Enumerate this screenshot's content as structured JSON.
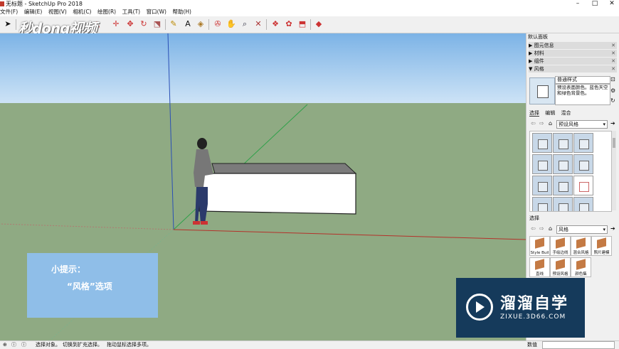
{
  "window": {
    "title": "无标题 - SketchUp Pro 2018"
  },
  "menu": [
    "文件(F)",
    "编辑(E)",
    "视图(V)",
    "相机(C)",
    "绘图(R)",
    "工具(T)",
    "窗口(W)",
    "帮助(H)"
  ],
  "logo": {
    "text": "秒dong视频"
  },
  "toolbar": {
    "icons": [
      "select-icon",
      "eraser-icon",
      "paint-icon",
      "line-icon",
      "arc-icon",
      "rectangle-icon",
      "pushpull-icon",
      "move-icon",
      "rotate-icon",
      "scale-icon",
      "tape-icon",
      "text-icon",
      "paint-bucket-icon",
      "orbit-icon",
      "pan-icon",
      "zoom-icon",
      "zoom-extents-icon",
      "warehouse-icon",
      "extension-icon",
      "share-icon",
      "ruby-icon"
    ]
  },
  "tip": {
    "line1": "小提示：",
    "line2": "“风格”选项"
  },
  "tray": {
    "title": "默认面板",
    "sections": [
      {
        "label": "图元信息",
        "collapsed": true
      },
      {
        "label": "材料",
        "collapsed": true
      },
      {
        "label": "组件",
        "collapsed": true
      },
      {
        "label": "风格",
        "collapsed": false
      }
    ],
    "style": {
      "name": "普通样式",
      "description": "预设表面颜色。蓝色天空和绿色背景色。"
    },
    "tabs": [
      "选择",
      "编辑",
      "混合"
    ],
    "dropdown1": "预设风格",
    "mix_label": "选择",
    "dropdown2": "风格",
    "swatches": [
      "Style Buil",
      "手绘边线",
      "混合风格",
      "照片建模",
      "直线",
      "预设风格",
      "颜色集"
    ]
  },
  "watermark": {
    "title": "溜溜自学",
    "url": "ZIXUE.3D66.COM"
  },
  "status": {
    "hint1": "选择对象。",
    "hint2": "切换到扩充选择。",
    "hint3": "拖动鼠标选择多项。",
    "measure_label": "数值"
  },
  "colors": {
    "sky": "#7cb3e6",
    "ground": "#8faa83",
    "tip": "#8fbee8",
    "watermark": "#153a5b"
  }
}
